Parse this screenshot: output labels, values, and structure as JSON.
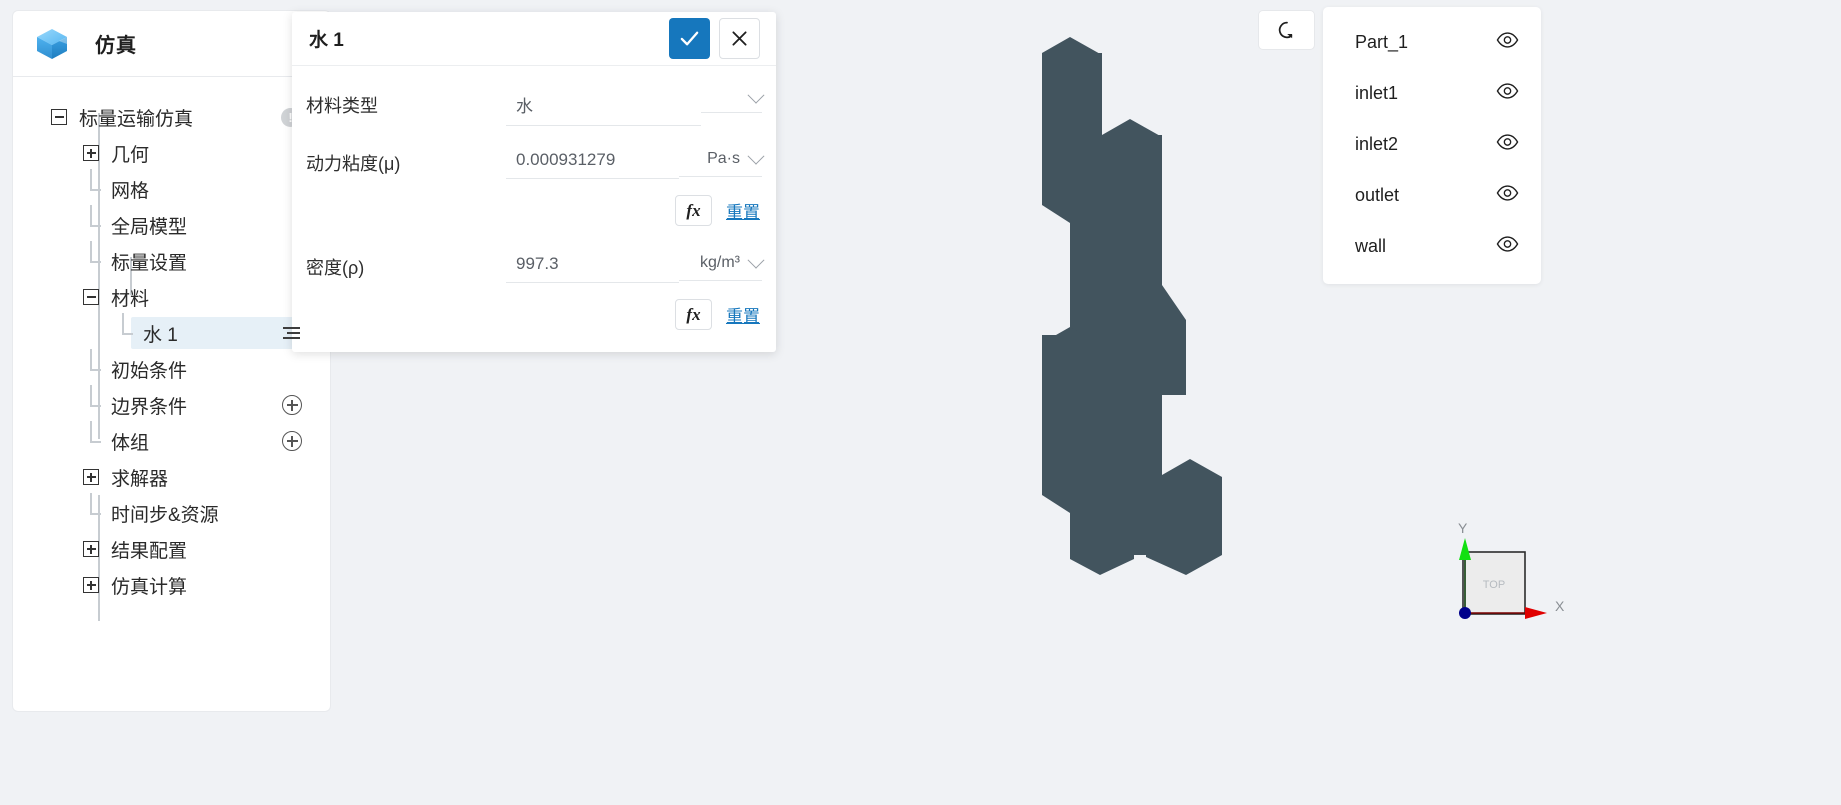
{
  "app": {
    "title": "仿真",
    "logo_icon": "cube-icon",
    "caret_icon": "caret-down-icon"
  },
  "sidebar": {
    "tree": [
      {
        "label": "标量运输仿真",
        "toggle": "minus",
        "indent": 0,
        "badge": "!"
      },
      {
        "label": "几何",
        "toggle": "plus",
        "indent": 1
      },
      {
        "label": "网格",
        "toggle": "leaf",
        "indent": 1
      },
      {
        "label": "全局模型",
        "toggle": "leaf",
        "indent": 1
      },
      {
        "label": "标量设置",
        "toggle": "leaf",
        "indent": 1
      },
      {
        "label": "材料",
        "toggle": "minus",
        "indent": 1
      },
      {
        "label": "水 1",
        "toggle": "leaf",
        "indent": 2,
        "selected": true,
        "menu_icon": "list-menu-icon"
      },
      {
        "label": "初始条件",
        "toggle": "leaf",
        "indent": 1
      },
      {
        "label": "边界条件",
        "toggle": "leaf",
        "indent": 1,
        "add_icon": "plus-circle-icon"
      },
      {
        "label": "体组",
        "toggle": "leaf",
        "indent": 1,
        "add_icon": "plus-circle-icon"
      },
      {
        "label": "求解器",
        "toggle": "plus",
        "indent": 1
      },
      {
        "label": "时间步&资源",
        "toggle": "leaf",
        "indent": 1
      },
      {
        "label": "结果配置",
        "toggle": "plus",
        "indent": 1
      },
      {
        "label": "仿真计算",
        "toggle": "plus",
        "indent": 1
      }
    ]
  },
  "dialog": {
    "title": "水 1",
    "confirm_icon": "check-icon",
    "cancel_icon": "close-icon",
    "fields": [
      {
        "label": "材料类型",
        "value": "水",
        "unit": "",
        "dropdown_icon": "chevron-down-icon"
      },
      {
        "label": "动力粘度(μ)",
        "value": "0.000931279",
        "unit": "Pa·s",
        "dropdown_icon": "chevron-down-icon",
        "fx_label": "fx",
        "reset_label": "重置"
      },
      {
        "label": "密度(ρ)",
        "value": "997.3",
        "unit": "kg/m³",
        "dropdown_icon": "chevron-down-icon",
        "fx_label": "fx",
        "reset_label": "重置"
      }
    ]
  },
  "viewport": {
    "reset_view_icon": "rotate-reset-icon",
    "geometry_color": "#42545e",
    "background_color": "#f0f2f5",
    "axis_gizmo": {
      "face_label": "TOP",
      "x_label": "X",
      "y_label": "Y",
      "x_color": "#c00000",
      "y_color": "#00c000",
      "origin_color": "#000080"
    }
  },
  "parts_panel": {
    "items": [
      {
        "name": "Part_1",
        "visibility_icon": "eye-icon"
      },
      {
        "name": "inlet1",
        "visibility_icon": "eye-icon"
      },
      {
        "name": "inlet2",
        "visibility_icon": "eye-icon"
      },
      {
        "name": "outlet",
        "visibility_icon": "eye-icon"
      },
      {
        "name": "wall",
        "visibility_icon": "eye-icon"
      }
    ]
  },
  "colors": {
    "accent": "#1677bd",
    "selected_row": "#e6f0f7",
    "link": "#1677bd"
  }
}
